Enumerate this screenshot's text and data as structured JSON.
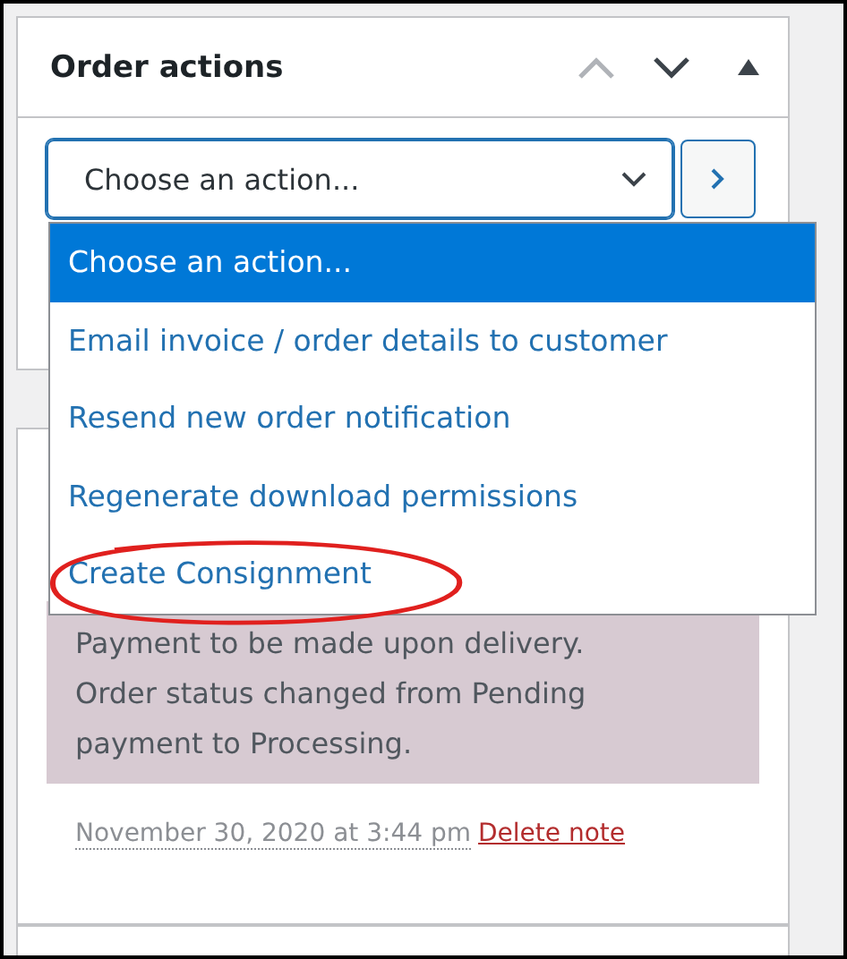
{
  "order_actions": {
    "title": "Order actions",
    "select": {
      "value": "Choose an action...",
      "expanded": true
    },
    "options": [
      {
        "label": "Choose an action...",
        "selected": true
      },
      {
        "label": "Email invoice / order details to customer",
        "selected": false
      },
      {
        "label": "Resend new order notification",
        "selected": false
      },
      {
        "label": "Regenerate download permissions",
        "selected": false
      },
      {
        "label": "Create Consignment",
        "selected": false,
        "circled": true
      }
    ]
  },
  "order_notes": {
    "note": {
      "text": "Payment to be made upon delivery. Order status changed from Pending payment to Processing.",
      "date": "November 30, 2020 at 3:44 pm",
      "delete_link": "Delete note"
    }
  }
}
